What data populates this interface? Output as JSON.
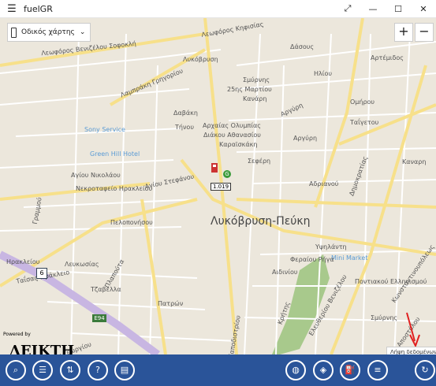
{
  "window": {
    "title": "fuelGR",
    "minimize": "—",
    "maximize": "☐",
    "close": "✕",
    "expand": "⤢",
    "menu": "☰"
  },
  "map_controls": {
    "map_type": "Οδικός χάρτης",
    "zoom_in": "+",
    "zoom_out": "−"
  },
  "map_labels": {
    "l1": "Λεωφόρος Βενιζέλου Σοφοκλή",
    "l2": "Λυκόβρυση",
    "l3": "Λαμπράκη Γρηγορίου",
    "l4": "Λεωφόρος Κηφισίας",
    "l5": "Δάσους",
    "l6": "Αρτέμιδος",
    "l7": "Σμύρνης",
    "l8": "25ης Μαρτίου",
    "l9": "Κανάρη",
    "l10": "Αρχαίας Ολυμπίας",
    "l11": "Διάκου Αθανασίου",
    "l12": "Καραϊσκάκη",
    "l13": "Αργύρη",
    "l14": "Sony Service",
    "l15": "Green Hill Hotel",
    "l16": "Σεφέρη",
    "l17": "Αγίου Νικολάου",
    "l18": "Νεκροταφείο Ηρακλείου",
    "l19": "Αγίου Στεφάνου",
    "l20": "Λυκόβρυση-Πεύκη",
    "l21": "Δημοκρατίας",
    "l22": "Αδριανού",
    "l23": "Ηρακλείου",
    "l24": "Πλαπούτα",
    "l25": "Mini Market",
    "l26": "Υψηλάντη",
    "l27": "Φεραίου Ρήγα",
    "l28": "Αιδινίου",
    "l29": "Ποντιακού Ελληνισμού",
    "l30": "Καποδιστρίου",
    "l31": "Ταΐσας-Ηράκλειο",
    "l32": "Ελευθερίου Βενιζέλου",
    "l33": "Λευκωσίας",
    "l34": "Τζαβέλλα",
    "l35": "Ηλίου",
    "l36": "Ομήρου",
    "l37": "Καναρη",
    "l38": "Ταΐγετου",
    "l39": "Σμύρνης",
    "l40": "Κρήτης",
    "l41": "Πατρών",
    "l42": "Αγίου Γεωργίου",
    "l43": "Κωνσταντινουπόλεως",
    "l44": "Γραμμού",
    "l45": "Αργύρη",
    "l46": "Δαβάκη",
    "l47": "Τήνου",
    "l48": "Πελοπονήσου",
    "l49": "Αποστόλου"
  },
  "map_markers": {
    "route_6": "6",
    "route_e94": "E94",
    "station_price": "1.019",
    "station_badge": "G"
  },
  "watermark": {
    "powered_by": "Powered by",
    "brand": "ΔΕΙΚΤΗ"
  },
  "tooltip": "Λήψη δεδομένων...",
  "colors": {
    "appbar": "#2a5499",
    "map_bg": "#ece7dc",
    "road_yellow": "#f7e08a",
    "road_white": "#ffffff",
    "highway": "#c8b6e2",
    "park": "#a8c98c",
    "arrow": "#e02020"
  },
  "appbar_icons": [
    "search-icon",
    "list-icon",
    "sort-icon",
    "help-icon",
    "fuel-card-icon",
    "globe-icon",
    "tag-icon",
    "fuel-pump-icon",
    "list-bullets-icon",
    "refresh-icon"
  ]
}
